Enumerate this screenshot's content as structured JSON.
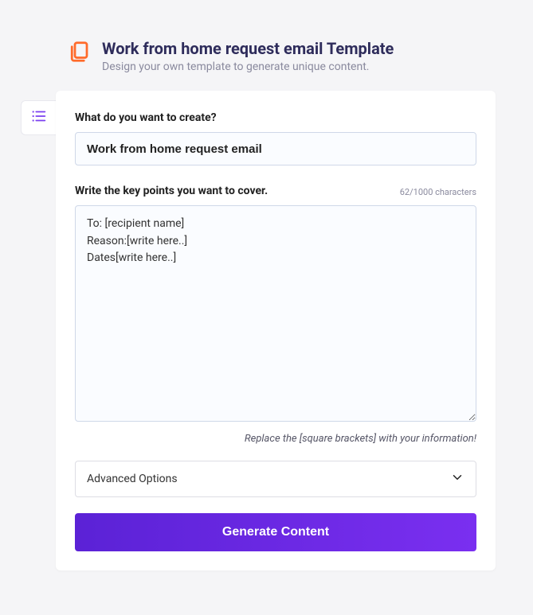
{
  "header": {
    "title": "Work from home request email Template",
    "subtitle": "Design your own template to generate unique content."
  },
  "form": {
    "create_label": "What do you want to create?",
    "create_value": "Work from home request email",
    "keypoints_label": "Write the key points you want to cover.",
    "char_counter": "62/1000 characters",
    "keypoints_value": "To: [recipient name]\nReason:[write here..]\nDates[write here..]",
    "hint": "Replace the [square brackets] with your information!",
    "advanced_label": "Advanced Options",
    "generate_label": "Generate Content"
  }
}
